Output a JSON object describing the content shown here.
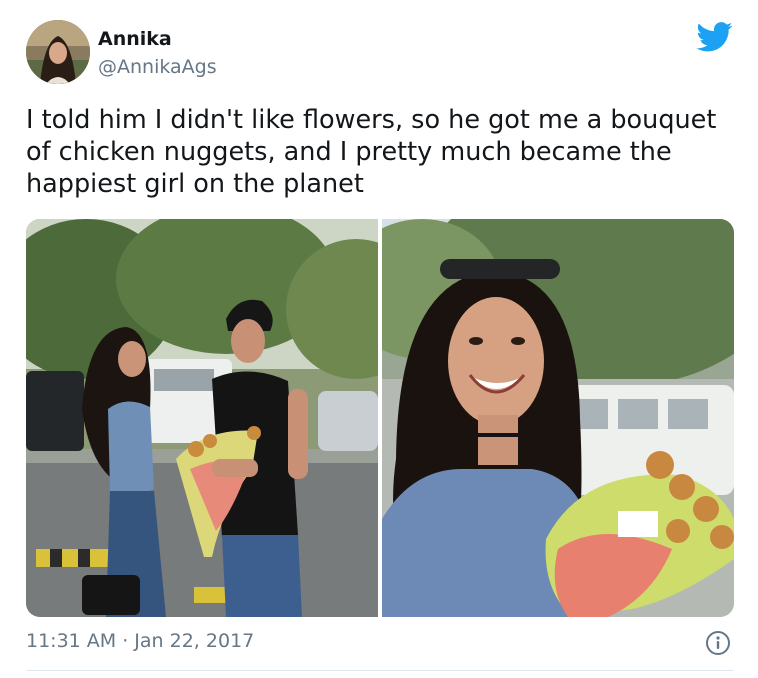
{
  "tweet": {
    "author": {
      "display_name": "Annika",
      "handle": "@AnnikaAgs"
    },
    "text": "I told him I didn't like flowers, so he got me a bouquet of chicken nuggets, and I pretty much became the happiest girl on the planet",
    "media": [
      {
        "name": "couple-with-nugget-bouquet-photo"
      },
      {
        "name": "smiling-girl-with-nugget-bouquet-photo"
      }
    ],
    "timestamp": "11:31 AM · Jan 22, 2017"
  },
  "icons": {
    "brand": "twitter-bird-icon",
    "info": "info-icon"
  },
  "colors": {
    "brand": "#1da1f2",
    "text": "#14171a",
    "secondary_text": "#657786",
    "divider": "#e1e8ed"
  }
}
